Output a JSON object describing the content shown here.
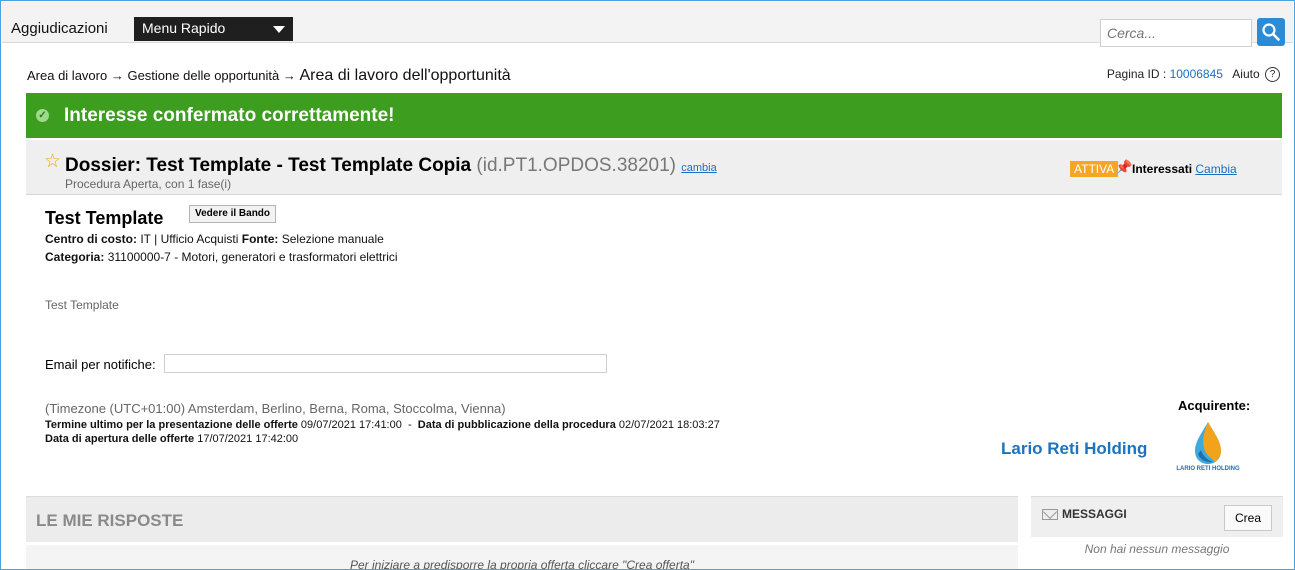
{
  "topbar": {
    "app_title": "Aggiudicazioni",
    "menu_label": "Menu Rapido",
    "search_placeholder": "Cerca..."
  },
  "breadcrumb": {
    "item1": "Area di lavoro",
    "sep": "→",
    "item2": "Gestione delle opportunità",
    "current": "Area di lavoro dell'opportunità"
  },
  "page_meta": {
    "label": "Pagina ID :",
    "id": "10006845",
    "help": "Aiuto",
    "help_glyph": "?"
  },
  "banner": {
    "message": "Interesse confermato correttamente!"
  },
  "dossier": {
    "title": "Dossier: Test Template - Test Template Copia",
    "id": "(id.PT1.OPDOS.38201)",
    "change_link": "cambia",
    "subtitle": "Procedura Aperta, con 1 fase(i)",
    "status": "ATTIVA",
    "interest_label": "Interessati",
    "interest_link": "Cambia"
  },
  "details": {
    "title": "Test Template",
    "view_button": "Vedere il Bando",
    "cost_center_label": "Centro di costo:",
    "cost_center_value": "IT | Ufficio Acquisti",
    "source_label": "Fonte:",
    "source_value": "Selezione manuale",
    "category_label": "Categoria:",
    "category_value": "31100000-7 - Motori, generatori e trasformatori elettrici",
    "description": "Test Template",
    "email_label": "Email per notifiche:",
    "email_value": "",
    "timezone": "(Timezone (UTC+01:00) Amsterdam, Berlino, Berna, Roma, Stoccolma, Vienna)",
    "deadline_label": "Termine ultimo per la presentazione delle offerte",
    "deadline_value": "09/07/2021 17:41:00",
    "dash": "-",
    "publication_label": "Data di pubblicazione della procedura",
    "publication_value": "02/07/2021 18:03:27",
    "opening_label": "Data di apertura delle offerte",
    "opening_value": "17/07/2021 17:42:00",
    "buyer_label": "Acquirente:",
    "buyer_name": "Lario Reti Holding",
    "buyer_logo_text": "LARIO RETI HOLDING"
  },
  "responses": {
    "title": "LE MIE RISPOSTE",
    "hint": "Per iniziare a predisporre la propria offerta cliccare \"Crea offerta\""
  },
  "messages": {
    "title": "MESSAGGI",
    "create_button": "Crea",
    "empty": "Non hai nessun messaggio"
  },
  "colors": {
    "banner_green": "#3c9d1e",
    "link_blue": "#1a6fc4",
    "status_orange": "#f5a623",
    "buyer_blue": "#1e73be"
  },
  "icons": [
    "search-icon",
    "caret-down-icon",
    "help-icon",
    "check-icon",
    "star-icon",
    "pin-icon",
    "envelope-icon",
    "drop-logo-icon"
  ]
}
